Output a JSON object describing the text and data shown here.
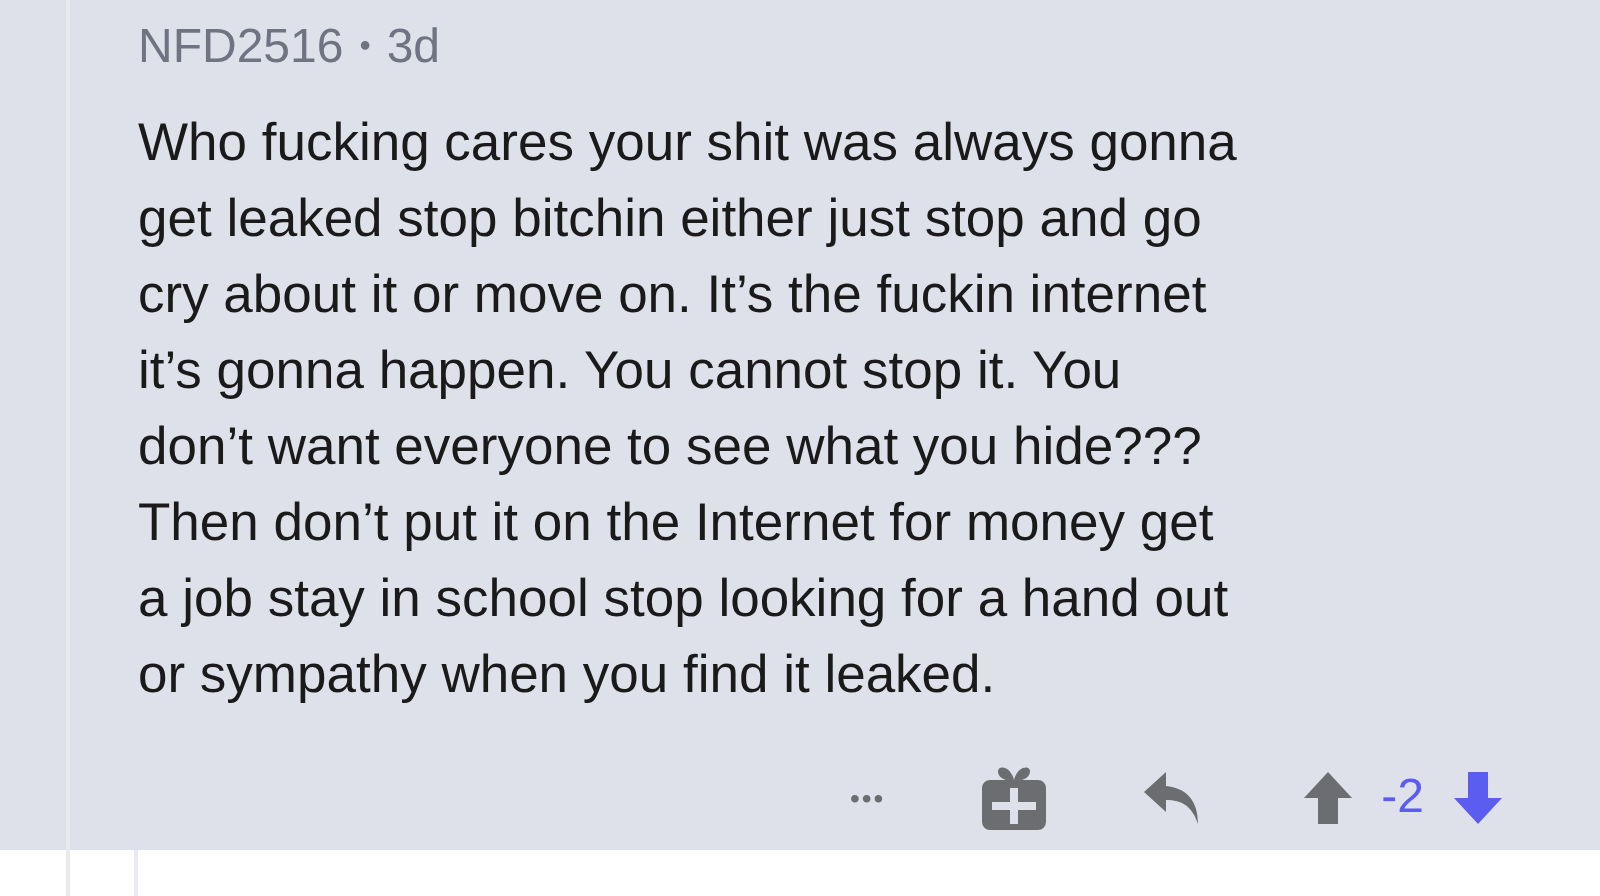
{
  "comment": {
    "author": "NFD2516",
    "separator": "•",
    "age": "3d",
    "body_lines": [
      "Who fucking cares your shit was always gonna",
      "get leaked stop bitchin either just stop and go",
      "cry about it or move on. It’s the fuckin internet",
      "it’s gonna happen. You cannot  stop it. You",
      "don’t want everyone to see what you hide???",
      "Then don’t put it on the Internet for money get",
      "a job stay in school stop looking for a hand out",
      "or sympathy when you find it leaked."
    ],
    "actions": {
      "more": "•••",
      "score": "-2",
      "upvoted": false,
      "downvoted": true
    }
  }
}
